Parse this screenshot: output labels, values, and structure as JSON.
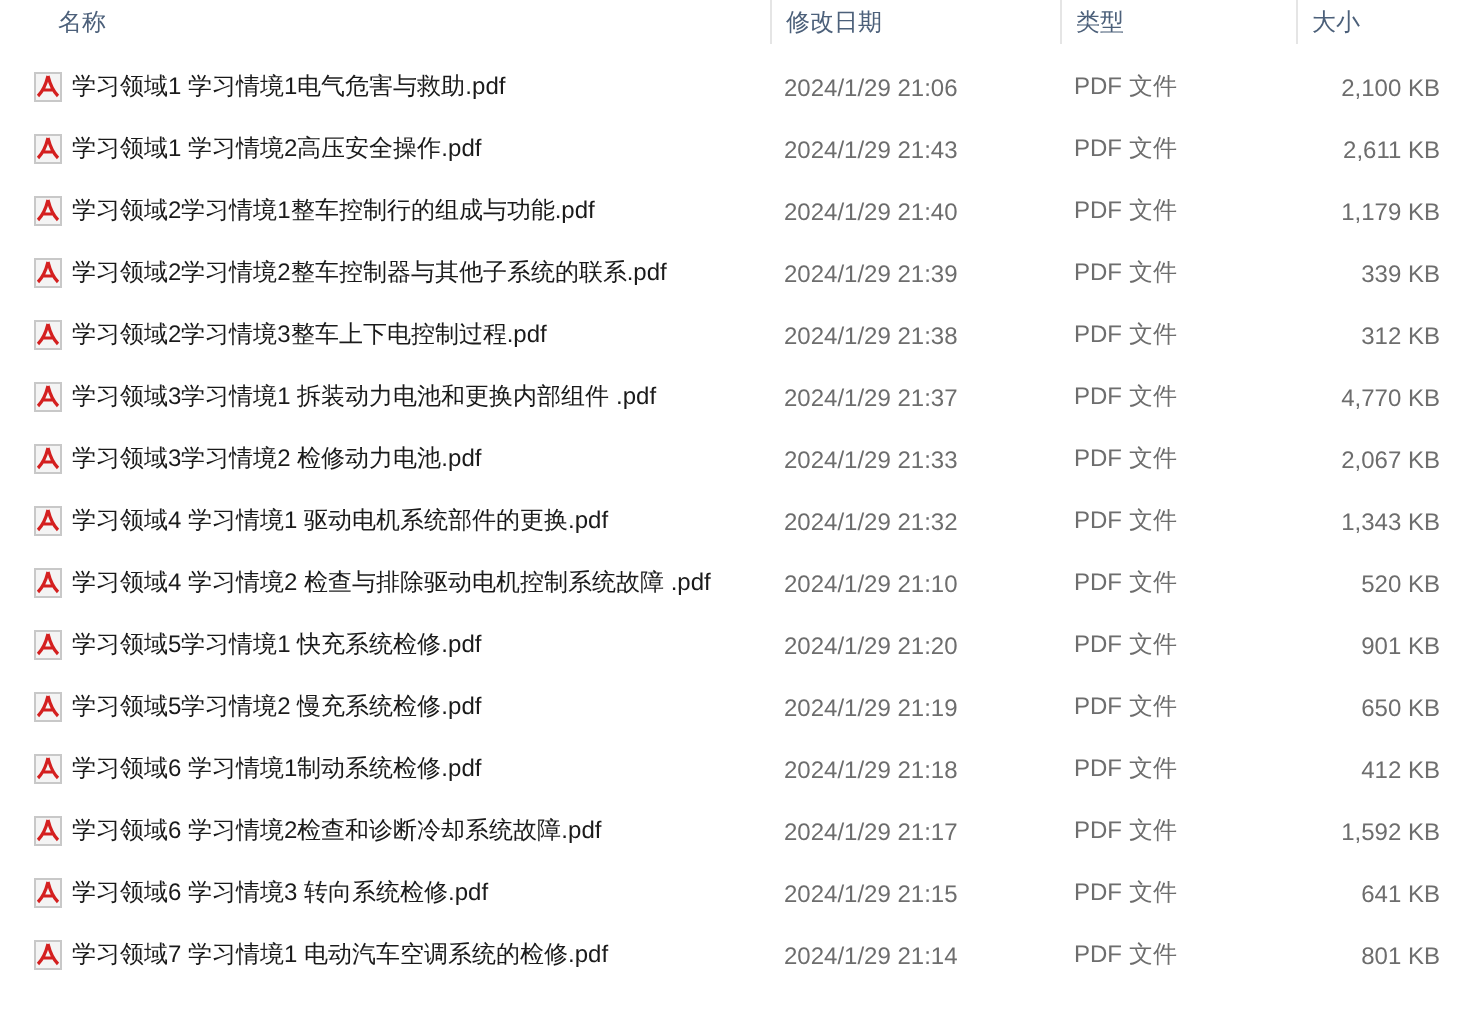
{
  "columns": [
    "名称",
    "修改日期",
    "类型",
    "大小"
  ],
  "rows": [
    {
      "name": "学习领域1 学习情境1电气危害与救助.pdf",
      "modified": "2024/1/29 21:06",
      "type": "PDF 文件",
      "size": "2,100 KB"
    },
    {
      "name": "学习领域1 学习情境2高压安全操作.pdf",
      "modified": "2024/1/29 21:43",
      "type": "PDF 文件",
      "size": "2,611 KB"
    },
    {
      "name": "学习领域2学习情境1整车控制行的组成与功能.pdf",
      "modified": "2024/1/29 21:40",
      "type": "PDF 文件",
      "size": "1,179 KB"
    },
    {
      "name": "学习领域2学习情境2整车控制器与其他子系统的联系.pdf",
      "modified": "2024/1/29 21:39",
      "type": "PDF 文件",
      "size": "339 KB"
    },
    {
      "name": "学习领域2学习情境3整车上下电控制过程.pdf",
      "modified": "2024/1/29 21:38",
      "type": "PDF 文件",
      "size": "312 KB"
    },
    {
      "name": "学习领域3学习情境1 拆装动力电池和更换内部组件 .pdf",
      "modified": "2024/1/29 21:37",
      "type": "PDF 文件",
      "size": "4,770 KB"
    },
    {
      "name": "学习领域3学习情境2 检修动力电池.pdf",
      "modified": "2024/1/29 21:33",
      "type": "PDF 文件",
      "size": "2,067 KB"
    },
    {
      "name": "学习领域4 学习情境1 驱动电机系统部件的更换.pdf",
      "modified": "2024/1/29 21:32",
      "type": "PDF 文件",
      "size": "1,343 KB"
    },
    {
      "name": "学习领域4 学习情境2 检查与排除驱动电机控制系统故障 .pdf",
      "modified": "2024/1/29 21:10",
      "type": "PDF 文件",
      "size": "520 KB"
    },
    {
      "name": "学习领域5学习情境1 快充系统检修.pdf",
      "modified": "2024/1/29 21:20",
      "type": "PDF 文件",
      "size": "901 KB"
    },
    {
      "name": "学习领域5学习情境2 慢充系统检修.pdf",
      "modified": "2024/1/29 21:19",
      "type": "PDF 文件",
      "size": "650 KB"
    },
    {
      "name": "学习领域6 学习情境1制动系统检修.pdf",
      "modified": "2024/1/29 21:18",
      "type": "PDF 文件",
      "size": "412 KB"
    },
    {
      "name": "学习领域6 学习情境2检查和诊断冷却系统故障.pdf",
      "modified": "2024/1/29 21:17",
      "type": "PDF 文件",
      "size": "1,592 KB"
    },
    {
      "name": "学习领域6 学习情境3 转向系统检修.pdf",
      "modified": "2024/1/29 21:15",
      "type": "PDF 文件",
      "size": "641 KB"
    },
    {
      "name": "学习领域7 学习情境1 电动汽车空调系统的检修.pdf",
      "modified": "2024/1/29 21:14",
      "type": "PDF 文件",
      "size": "801 KB"
    }
  ]
}
